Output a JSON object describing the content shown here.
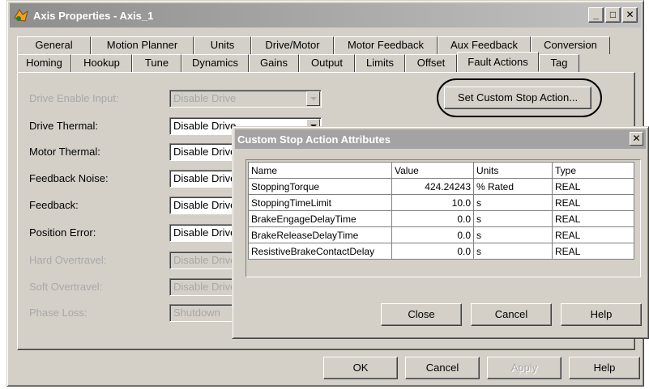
{
  "window": {
    "title": "Axis Properties - Axis_1",
    "minimize": "_",
    "maximize": "□",
    "close": "✕"
  },
  "tabs": {
    "back_row": [
      "General",
      "Motion Planner",
      "Units",
      "Drive/Motor",
      "Motor Feedback",
      "Aux Feedback",
      "Conversion"
    ],
    "front_row": [
      "Homing",
      "Hookup",
      "Tune",
      "Dynamics",
      "Gains",
      "Output",
      "Limits",
      "Offset",
      "Fault Actions",
      "Tag"
    ],
    "active": "Fault Actions"
  },
  "fault_actions": [
    {
      "label": "Drive Enable Input:",
      "value": "Disable Drive",
      "disabled": true
    },
    {
      "label": "Drive Thermal:",
      "value": "Disable Drive",
      "disabled": false
    },
    {
      "label": "Motor Thermal:",
      "value": "Disable Drive",
      "disabled": false
    },
    {
      "label": "Feedback Noise:",
      "value": "Disable Drive",
      "disabled": false
    },
    {
      "label": "Feedback:",
      "value": "Disable Drive",
      "disabled": false
    },
    {
      "label": "Position Error:",
      "value": "Disable Drive",
      "disabled": false
    },
    {
      "label": "Hard Overtravel:",
      "value": "Disable Drive",
      "disabled": true
    },
    {
      "label": "Soft Overtravel:",
      "value": "Disable Drive",
      "disabled": true
    },
    {
      "label": "Phase Loss:",
      "value": "Shutdown",
      "disabled": true
    }
  ],
  "set_custom_stop_button": "Set Custom Stop Action...",
  "footer": {
    "ok": "OK",
    "cancel": "Cancel",
    "apply": "Apply",
    "help": "Help"
  },
  "dialog": {
    "title": "Custom Stop Action Attributes",
    "close": "✕",
    "columns": [
      "Name",
      "Value",
      "Units",
      "Type"
    ],
    "rows": [
      {
        "name": "StoppingTorque",
        "value": "424.24243",
        "units": "% Rated",
        "type": "REAL"
      },
      {
        "name": "StoppingTimeLimit",
        "value": "10.0",
        "units": "s",
        "type": "REAL"
      },
      {
        "name": "BrakeEngageDelayTime",
        "value": "0.0",
        "units": "s",
        "type": "REAL"
      },
      {
        "name": "BrakeReleaseDelayTime",
        "value": "0.0",
        "units": "s",
        "type": "REAL"
      },
      {
        "name": "ResistiveBrakeContactDelay",
        "value": "0.0",
        "units": "s",
        "type": "REAL"
      }
    ],
    "close_button": "Close",
    "cancel_button": "Cancel",
    "help_button": "Help"
  }
}
